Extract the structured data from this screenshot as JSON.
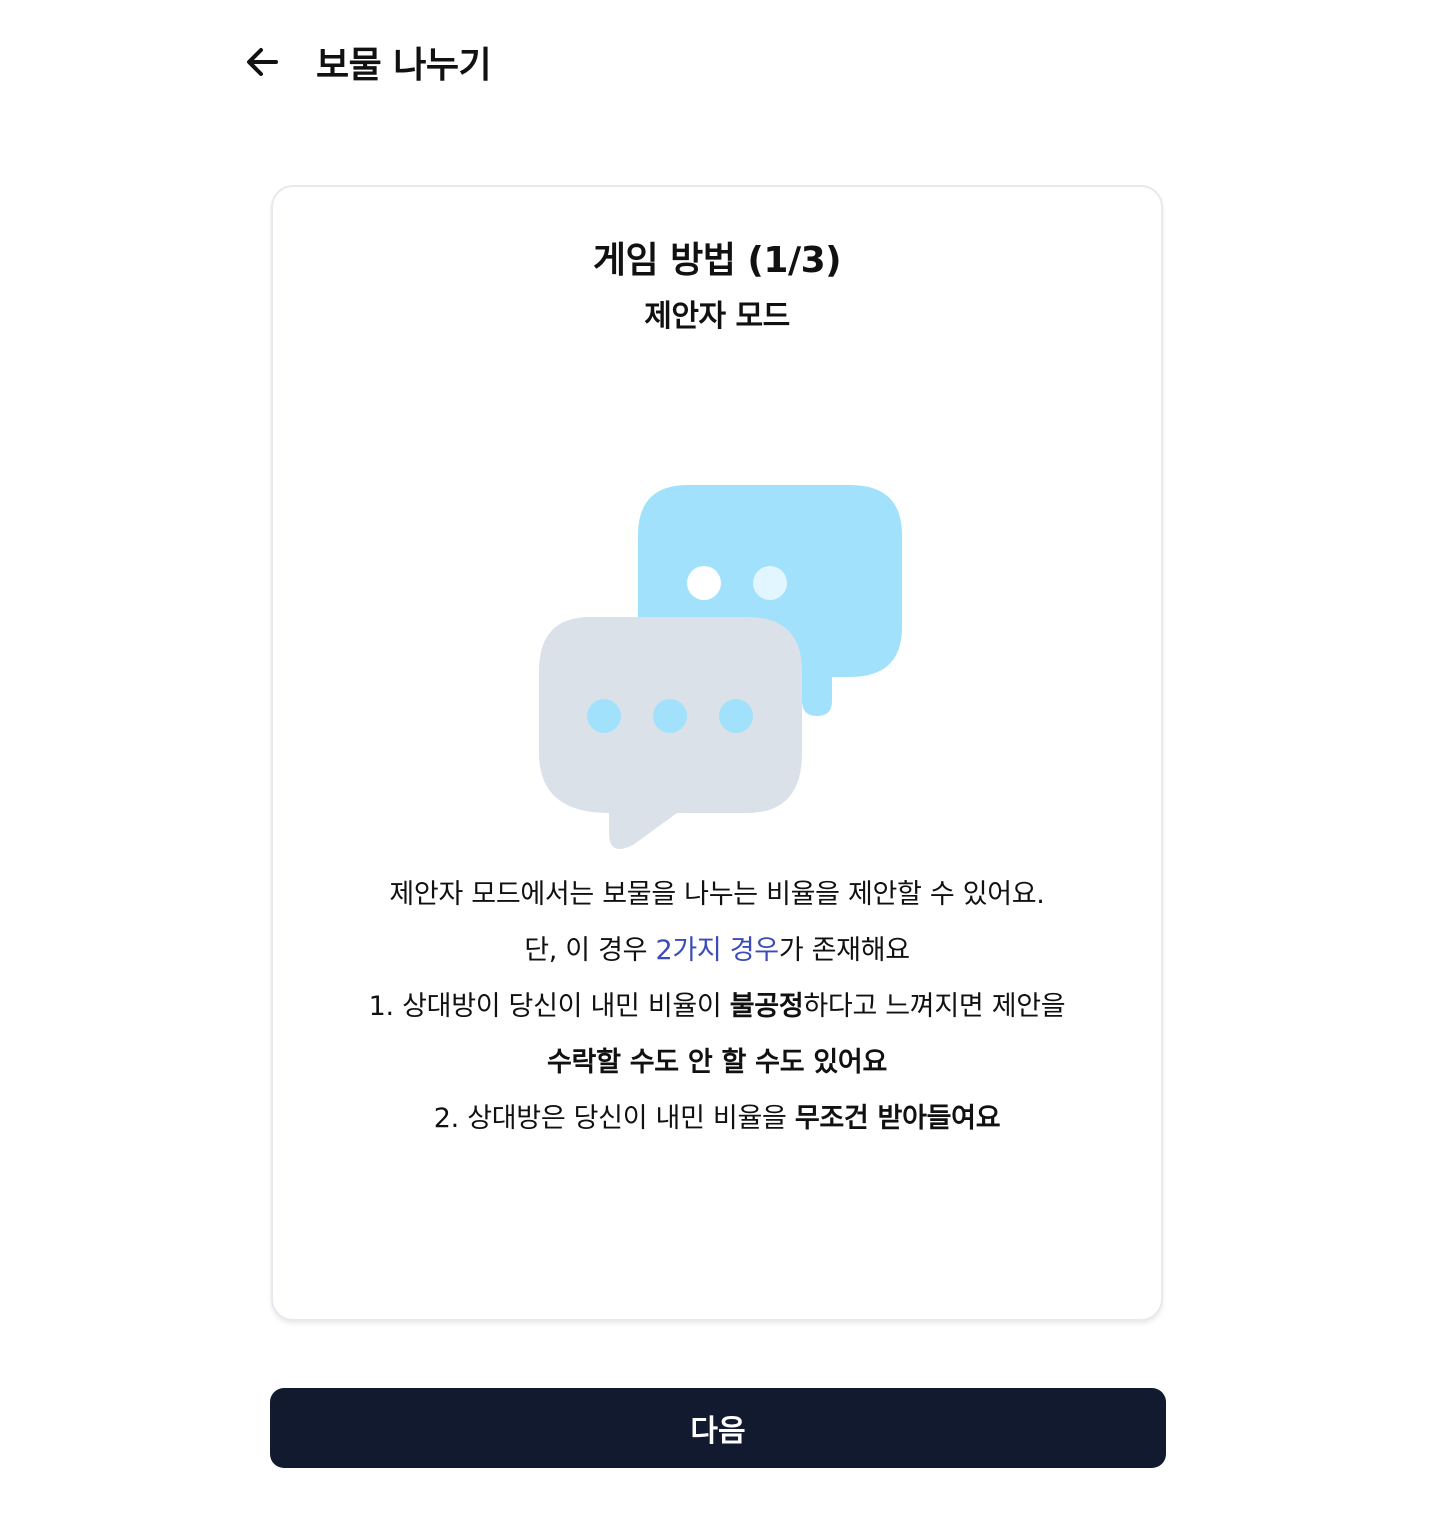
{
  "header": {
    "title": "보물 나누기",
    "back_icon": "arrow-left-icon"
  },
  "card": {
    "title": "게임 방법 (1/3)",
    "subtitle": "제안자 모드",
    "illustration_icon": "chat-bubbles-icon",
    "colors": {
      "front_bubble": "#dbe1e8",
      "back_bubble": "#a2e1fb",
      "dots_light": "#ffffff",
      "dots_blue": "#a2e1fb"
    },
    "description": {
      "line1": "제안자 모드에서는 보물을 나누는 비율을 제안할 수 있어요.",
      "line2_pre": "단, 이 경우 ",
      "line2_highlight": "2가지 경우",
      "line2_post": "가 존재해요",
      "line3_pre": "1. 상대방이 당신이 내민 비율이 ",
      "line3_bold": "불공정",
      "line3_post": "하다고 느껴지면 제안을",
      "line4_bold": "수락할 수도 안 할 수도 있어요",
      "line5_pre": "2. 상대방은 당신이 내민 비율을 ",
      "line5_bold": "무조건 받아들여요"
    },
    "highlight_color": "#3b4cb8"
  },
  "footer": {
    "next_label": "다음",
    "button_color": "#111a2e"
  }
}
